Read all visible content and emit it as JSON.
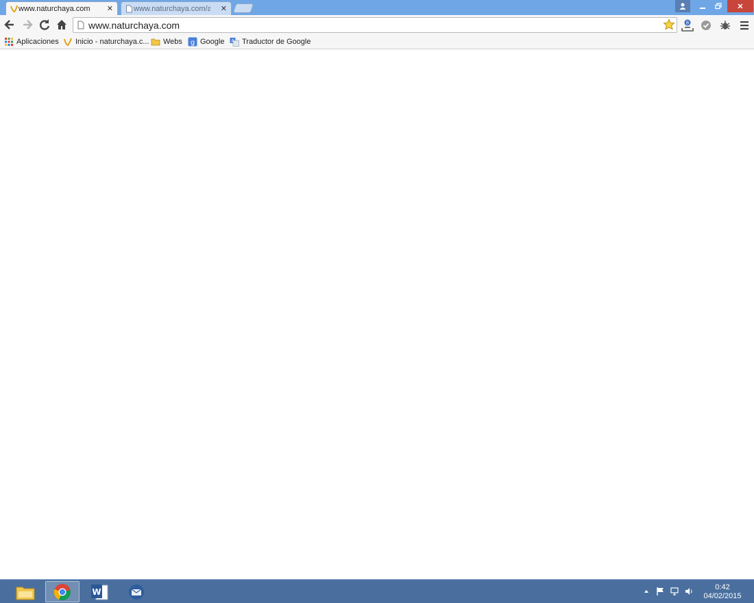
{
  "browser": {
    "tabs": [
      {
        "title": "www.naturchaya.com",
        "active": true
      },
      {
        "title": "www.naturchaya.com/adn",
        "active": false
      }
    ],
    "address": "www.naturchaya.com",
    "window_controls": [
      "user-icon",
      "minimize-icon",
      "maximize-icon",
      "close-icon"
    ]
  },
  "bookmarks": [
    {
      "label": "Aplicaciones",
      "icon": "apps-grid-icon"
    },
    {
      "label": "Inicio - naturchaya.c...",
      "icon": "naturchaya-favicon"
    },
    {
      "label": "Webs",
      "icon": "folder-icon"
    },
    {
      "label": "Google",
      "icon": "google-icon"
    },
    {
      "label": "Traductor de Google",
      "icon": "translate-icon"
    }
  ],
  "taskbar": {
    "apps": [
      "file-explorer-icon",
      "chrome-icon",
      "word-icon",
      "thunderbird-icon"
    ],
    "clock": {
      "time": "0:42",
      "date": "04/02/2015"
    }
  },
  "colors": {
    "tabstrip": "#6fa7e6",
    "toolbar": "#f6f6f6",
    "taskbar": "#4a6f9e",
    "close_button": "#c7453a"
  }
}
